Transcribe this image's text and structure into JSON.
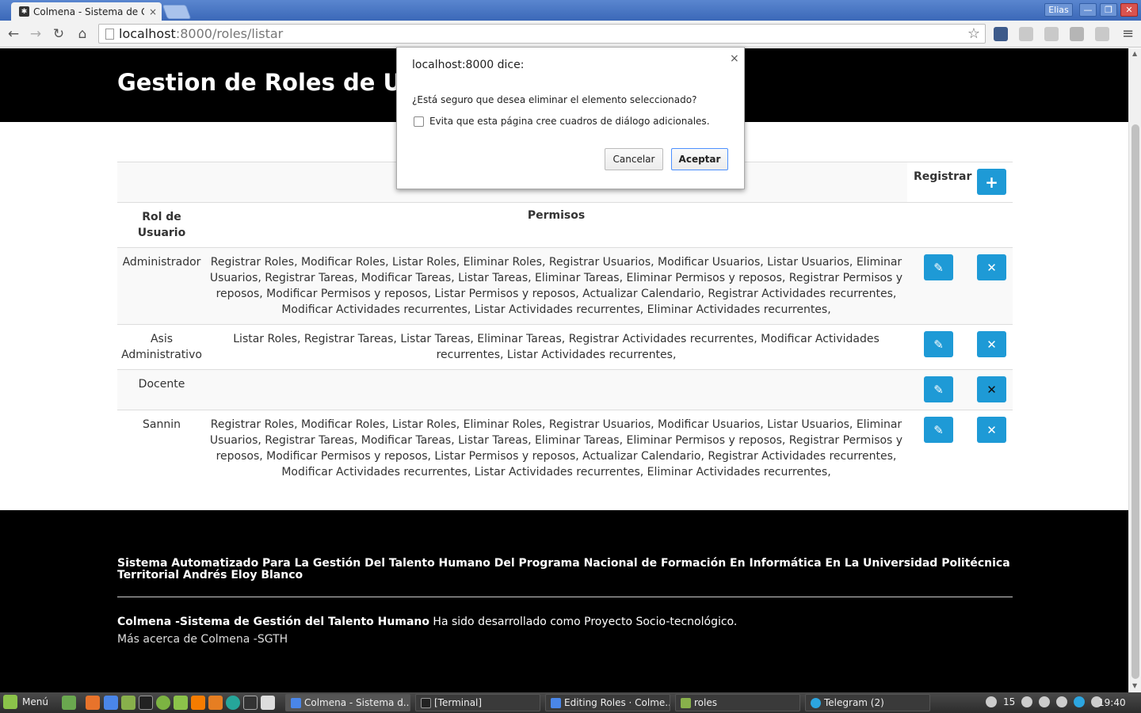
{
  "browser": {
    "tab_title": "Colmena - Sistema de Ge",
    "tab_close": "×",
    "user_button": "Elias",
    "url_host": "localhost",
    "url_path": ":8000/roles/listar"
  },
  "page": {
    "title": "Gestion de Roles de Usuarios",
    "register_label": "Registrar",
    "columns": {
      "role": "Rol de Usuario",
      "permissions": "Permisos"
    },
    "rows": [
      {
        "role": "Administrador",
        "permissions": "Registrar Roles, Modificar Roles, Listar Roles, Eliminar Roles, Registrar Usuarios, Modificar Usuarios, Listar Usuarios, Eliminar Usuarios, Registrar Tareas, Modificar Tareas, Listar Tareas, Eliminar Tareas, Eliminar Permisos y reposos, Registrar Permisos y reposos, Modificar Permisos y reposos, Listar Permisos y reposos, Actualizar Calendario, Registrar Actividades recurrentes, Modificar Actividades recurrentes, Listar Actividades recurrentes, Eliminar Actividades recurrentes,"
      },
      {
        "role": "Asis Administrativo",
        "permissions": "Listar Roles, Registrar Tareas, Listar Tareas, Eliminar Tareas, Registrar Actividades recurrentes, Modificar Actividades recurrentes, Listar Actividades recurrentes,"
      },
      {
        "role": "Docente",
        "permissions": ""
      },
      {
        "role": "Sannin",
        "permissions": "Registrar Roles, Modificar Roles, Listar Roles, Eliminar Roles, Registrar Usuarios, Modificar Usuarios, Listar Usuarios, Eliminar Usuarios, Registrar Tareas, Modificar Tareas, Listar Tareas, Eliminar Tareas, Eliminar Permisos y reposos, Registrar Permisos y reposos, Modificar Permisos y reposos, Listar Permisos y reposos, Actualizar Calendario, Registrar Actividades recurrentes, Modificar Actividades recurrentes, Listar Actividades recurrentes, Eliminar Actividades recurrentes,"
      }
    ]
  },
  "footer": {
    "title": "Sistema Automatizado Para La Gestión Del Talento Humano Del Programa Nacional de Formación En Informática En La Universidad Politécnica Territorial Andrés Eloy Blanco",
    "brand": "Colmena -Sistema de Gestión del Talento Humano",
    "tagline": " Ha sido desarrollado como Proyecto Socio-tecnológico.",
    "more": "Más acerca de Colmena -SGTH"
  },
  "dialog": {
    "title": "localhost:8000 dice:",
    "close": "×",
    "message": "¿Está seguro que desea eliminar el elemento seleccionado?",
    "checkbox_label": "Evita que esta página cree cuadros de diálogo adicionales.",
    "cancel": "Cancelar",
    "ok": "Aceptar"
  },
  "taskbar": {
    "menu": "Menú",
    "tasks": [
      {
        "label": "Colmena - Sistema d..."
      },
      {
        "label": "[Terminal]"
      },
      {
        "label": "Editing Roles · Colme..."
      },
      {
        "label": "roles"
      },
      {
        "label": "Telegram (2)"
      }
    ],
    "tray_count": "15",
    "clock": "19:40"
  },
  "icons": {
    "back": "back-arrow-icon",
    "forward": "forward-arrow-icon",
    "reload": "reload-icon",
    "home": "home-icon",
    "star": "star-icon",
    "menu": "hamburger-menu-icon",
    "add": "plus-icon",
    "edit": "pencil-icon",
    "delete": "times-icon"
  },
  "colors": {
    "accent": "#1e9ad6",
    "header_bg": "#000000",
    "dialog_ok_border": "#4d90fe"
  }
}
